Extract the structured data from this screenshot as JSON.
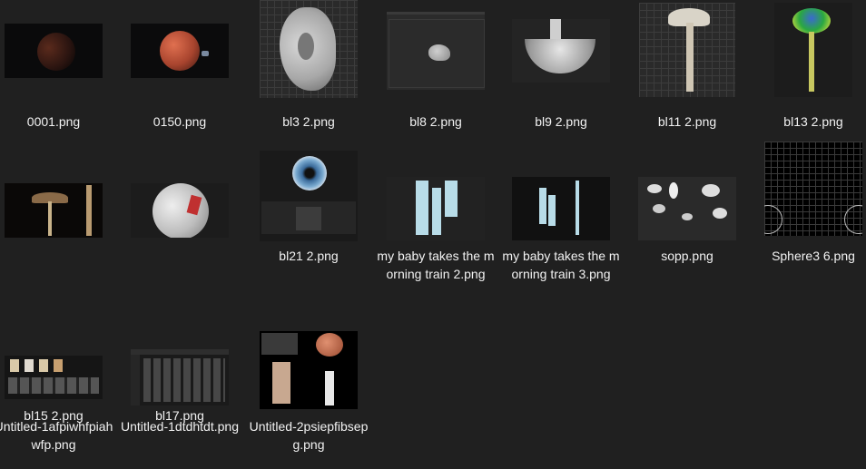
{
  "files": [
    {
      "name": "0001.png",
      "thumb": "planet-dark-icon"
    },
    {
      "name": "0150.png",
      "thumb": "planet-orange-icon"
    },
    {
      "name": "bl3 2.png",
      "thumb": "ear-model-icon"
    },
    {
      "name": "bl8 2.png",
      "thumb": "drop-model-icon"
    },
    {
      "name": "bl9 2.png",
      "thumb": "bowl-model-icon"
    },
    {
      "name": "bl11 2.png",
      "thumb": "mushroom-white-icon"
    },
    {
      "name": "bl13 2.png",
      "thumb": "mushroom-green-icon"
    },
    {
      "name": "bl15 2.png",
      "thumb": "mushrooms-render-icon"
    },
    {
      "name": "bl17.png",
      "thumb": "sphere-texture-icon"
    },
    {
      "name": "bl21 2.png",
      "thumb": "eye-editor-icon"
    },
    {
      "name": "my baby takes the morning train 2.png",
      "thumb": "bars-chart-icon"
    },
    {
      "name": "my baby takes the morning train 3.png",
      "thumb": "bars-chart-icon"
    },
    {
      "name": "sopp.png",
      "thumb": "mushroom-collection-icon"
    },
    {
      "name": "Sphere3 6.png",
      "thumb": "sphere-grid-icon"
    },
    {
      "name": "Untitled-1afpiwhfpiahwfp.png",
      "thumb": "thumbnail-grid-icon"
    },
    {
      "name": "Untitled-1dtdhtdt.png",
      "thumb": "file-browser-icon"
    },
    {
      "name": "Untitled-2psiepfibsepg.png",
      "thumb": "collage-icon"
    }
  ]
}
